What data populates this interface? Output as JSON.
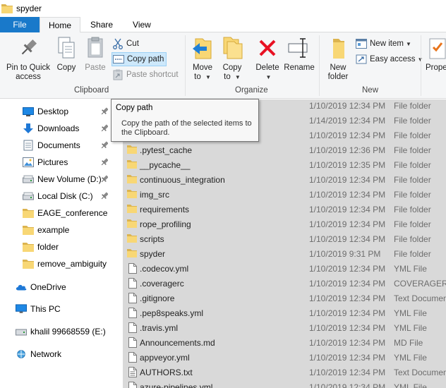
{
  "window": {
    "title": "spyder"
  },
  "tabs": [
    {
      "label": "File"
    },
    {
      "label": "Home"
    },
    {
      "label": "Share"
    },
    {
      "label": "View"
    }
  ],
  "ribbon": {
    "clipboard": {
      "pin_label": "Pin to Quick\naccess",
      "copy_label": "Copy",
      "paste_label": "Paste",
      "cut_label": "Cut",
      "copy_path_label": "Copy path",
      "paste_shortcut_label": "Paste shortcut",
      "group_label": "Clipboard"
    },
    "organize": {
      "move_to_label": "Move\nto",
      "copy_to_label": "Copy\nto",
      "delete_label": "Delete",
      "rename_label": "Rename",
      "group_label": "Organize"
    },
    "new": {
      "new_folder_label": "New\nfolder",
      "new_item_label": "New item",
      "easy_access_label": "Easy access",
      "group_label": "New"
    },
    "open": {
      "properties_label": "Prope"
    }
  },
  "tooltip": {
    "title": "Copy path",
    "body": "Copy the path of the selected items to the Clipboard."
  },
  "navpane": {
    "items": [
      {
        "label": "Desktop",
        "icon": "desktop-icon",
        "pinned": true
      },
      {
        "label": "Downloads",
        "icon": "download-icon",
        "pinned": true
      },
      {
        "label": "Documents",
        "icon": "documents-icon",
        "pinned": true
      },
      {
        "label": "Pictures",
        "icon": "pictures-icon",
        "pinned": true
      },
      {
        "label": "New Volume (D:)",
        "icon": "drive-icon",
        "pinned": true
      },
      {
        "label": "Local Disk (C:)",
        "icon": "drive-icon",
        "pinned": true
      },
      {
        "label": "EAGE_conference",
        "icon": "folder-icon",
        "pinned": false
      },
      {
        "label": "example",
        "icon": "folder-icon",
        "pinned": false
      },
      {
        "label": "folder",
        "icon": "folder-icon",
        "pinned": false
      },
      {
        "label": "remove_ambiguity",
        "icon": "folder-icon",
        "pinned": false
      },
      {
        "label": "OneDrive",
        "icon": "onedrive-icon",
        "pinned": false
      },
      {
        "label": "This PC",
        "icon": "this-pc-icon",
        "pinned": false
      },
      {
        "label": "khalil 99668559 (E:)",
        "icon": "usb-drive-icon",
        "pinned": false
      },
      {
        "label": "Network",
        "icon": "network-icon",
        "pinned": false
      }
    ]
  },
  "files": [
    {
      "name": "",
      "date": "1/10/2019 12:34 PM",
      "type": "File folder",
      "kind": "folder"
    },
    {
      "name": "",
      "date": "1/14/2019 12:34 PM",
      "type": "File folder",
      "kind": "folder"
    },
    {
      "name": "",
      "date": "1/10/2019 12:34 PM",
      "type": "File folder",
      "kind": "folder"
    },
    {
      "name": ".pytest_cache",
      "date": "1/10/2019 12:36 PM",
      "type": "File folder",
      "kind": "folder"
    },
    {
      "name": "__pycache__",
      "date": "1/10/2019 12:35 PM",
      "type": "File folder",
      "kind": "folder"
    },
    {
      "name": "continuous_integration",
      "date": "1/10/2019 12:34 PM",
      "type": "File folder",
      "kind": "folder"
    },
    {
      "name": "img_src",
      "date": "1/10/2019 12:34 PM",
      "type": "File folder",
      "kind": "folder"
    },
    {
      "name": "requirements",
      "date": "1/10/2019 12:34 PM",
      "type": "File folder",
      "kind": "folder"
    },
    {
      "name": "rope_profiling",
      "date": "1/10/2019 12:34 PM",
      "type": "File folder",
      "kind": "folder"
    },
    {
      "name": "scripts",
      "date": "1/10/2019 12:34 PM",
      "type": "File folder",
      "kind": "folder"
    },
    {
      "name": "spyder",
      "date": "1/10/2019 9:31 PM",
      "type": "File folder",
      "kind": "folder"
    },
    {
      "name": ".codecov.yml",
      "date": "1/10/2019 12:34 PM",
      "type": "YML File",
      "kind": "file"
    },
    {
      "name": ".coveragerc",
      "date": "1/10/2019 12:34 PM",
      "type": "COVERAGERC",
      "kind": "file"
    },
    {
      "name": ".gitignore",
      "date": "1/10/2019 12:34 PM",
      "type": "Text Documen",
      "kind": "file"
    },
    {
      "name": ".pep8speaks.yml",
      "date": "1/10/2019 12:34 PM",
      "type": "YML File",
      "kind": "file"
    },
    {
      "name": ".travis.yml",
      "date": "1/10/2019 12:34 PM",
      "type": "YML File",
      "kind": "file"
    },
    {
      "name": "Announcements.md",
      "date": "1/10/2019 12:34 PM",
      "type": "MD File",
      "kind": "file"
    },
    {
      "name": "appveyor.yml",
      "date": "1/10/2019 12:34 PM",
      "type": "YML File",
      "kind": "file"
    },
    {
      "name": "AUTHORS.txt",
      "date": "1/10/2019 12:34 PM",
      "type": "Text Documen",
      "kind": "textfile"
    },
    {
      "name": "azure-pipelines.yml",
      "date": "1/10/2019 12:34 PM",
      "type": "YML File",
      "kind": "file"
    }
  ],
  "colors": {
    "file_tab": "#1979ca",
    "folder_yellow": "#f8d775",
    "selection": "#d9d9d9",
    "delete_red": "#e81123"
  }
}
